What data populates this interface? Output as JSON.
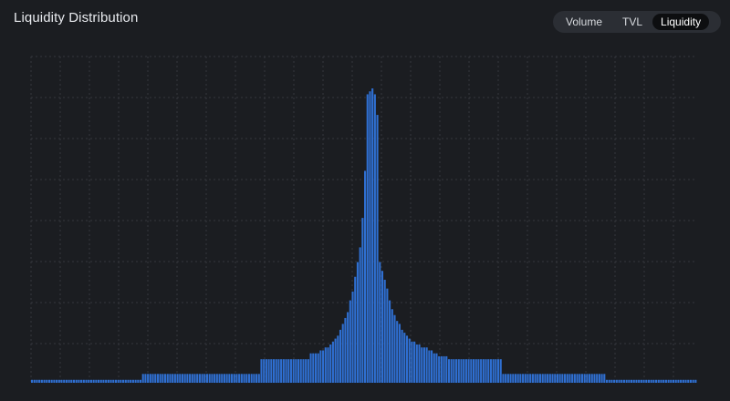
{
  "header": {
    "title": "Liquidity Distribution"
  },
  "toggle": {
    "options": [
      "Volume",
      "TVL",
      "Liquidity"
    ],
    "active": "Liquidity"
  },
  "colors": {
    "bar": "#2f6fd1",
    "background": "#1b1d21",
    "grid": "#34373d"
  },
  "chart_data": {
    "type": "bar",
    "title": "Liquidity Distribution",
    "xlabel": "",
    "ylabel": "",
    "grid": true,
    "ylim": [
      0,
      100
    ],
    "values": [
      1,
      1,
      1,
      1,
      1,
      1,
      1,
      1,
      1,
      1,
      1,
      1,
      1,
      1,
      1,
      1,
      1,
      1,
      1,
      1,
      1,
      1,
      1,
      1,
      1,
      1,
      1,
      1,
      1,
      1,
      1,
      1,
      1,
      1,
      1,
      1,
      1,
      1,
      1,
      1,
      1,
      1,
      1,
      1,
      1,
      3,
      3,
      3,
      3,
      3,
      3,
      3,
      3,
      3,
      3,
      3,
      3,
      3,
      3,
      3,
      3,
      3,
      3,
      3,
      3,
      3,
      3,
      3,
      3,
      3,
      3,
      3,
      3,
      3,
      3,
      3,
      3,
      3,
      3,
      3,
      3,
      3,
      3,
      3,
      3,
      3,
      3,
      3,
      3,
      3,
      3,
      3,
      3,
      8,
      8,
      8,
      8,
      8,
      8,
      8,
      8,
      8,
      8,
      8,
      8,
      8,
      8,
      8,
      8,
      8,
      8,
      8,
      8,
      10,
      10,
      10,
      10,
      11,
      11,
      12,
      12,
      13,
      14,
      15,
      16,
      18,
      20,
      22,
      24,
      28,
      31,
      36,
      41,
      46,
      56,
      72,
      98,
      99,
      100,
      98,
      91,
      41,
      38,
      35,
      32,
      28,
      25,
      23,
      21,
      20,
      18,
      17,
      16,
      15,
      14,
      14,
      13,
      13,
      12,
      12,
      12,
      11,
      11,
      10,
      10,
      9,
      9,
      9,
      9,
      8,
      8,
      8,
      8,
      8,
      8,
      8,
      8,
      8,
      8,
      8,
      8,
      8,
      8,
      8,
      8,
      8,
      8,
      8,
      8,
      8,
      8,
      3,
      3,
      3,
      3,
      3,
      3,
      3,
      3,
      3,
      3,
      3,
      3,
      3,
      3,
      3,
      3,
      3,
      3,
      3,
      3,
      3,
      3,
      3,
      3,
      3,
      3,
      3,
      3,
      3,
      3,
      3,
      3,
      3,
      3,
      3,
      3,
      3,
      3,
      3,
      3,
      3,
      3,
      1,
      1,
      1,
      1,
      1,
      1,
      1,
      1,
      1,
      1,
      1,
      1,
      1,
      1,
      1,
      1,
      1,
      1,
      1,
      1,
      1,
      1,
      1,
      1,
      1,
      1,
      1,
      1,
      1,
      1,
      1,
      1,
      1,
      1,
      1,
      1,
      1
    ]
  }
}
